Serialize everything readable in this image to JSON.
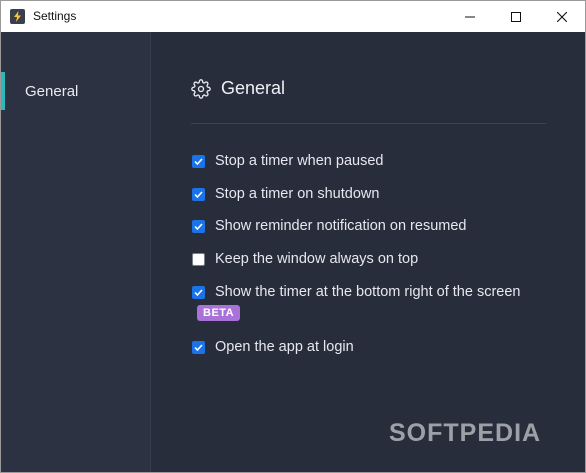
{
  "window": {
    "title": "Settings"
  },
  "sidebar": {
    "items": [
      {
        "label": "General",
        "active": true
      }
    ]
  },
  "main": {
    "heading": "General",
    "options": [
      {
        "label": "Stop a timer when paused",
        "checked": true
      },
      {
        "label": "Stop a timer on shutdown",
        "checked": true
      },
      {
        "label": "Show reminder notification on resumed",
        "checked": true
      },
      {
        "label": "Keep the window always on top",
        "checked": false
      },
      {
        "label": "Show the timer at the bottom right of the screen",
        "checked": true,
        "badge": "BETA"
      },
      {
        "label": "Open the app at login",
        "checked": true
      }
    ]
  },
  "watermark": "SOFTPEDIA",
  "colors": {
    "accent": "#2fb8b8",
    "checkbox": "#1a73e8",
    "beta_badge": "#a872d8",
    "background": "#282d3c",
    "sidebar": "#2c3241"
  }
}
